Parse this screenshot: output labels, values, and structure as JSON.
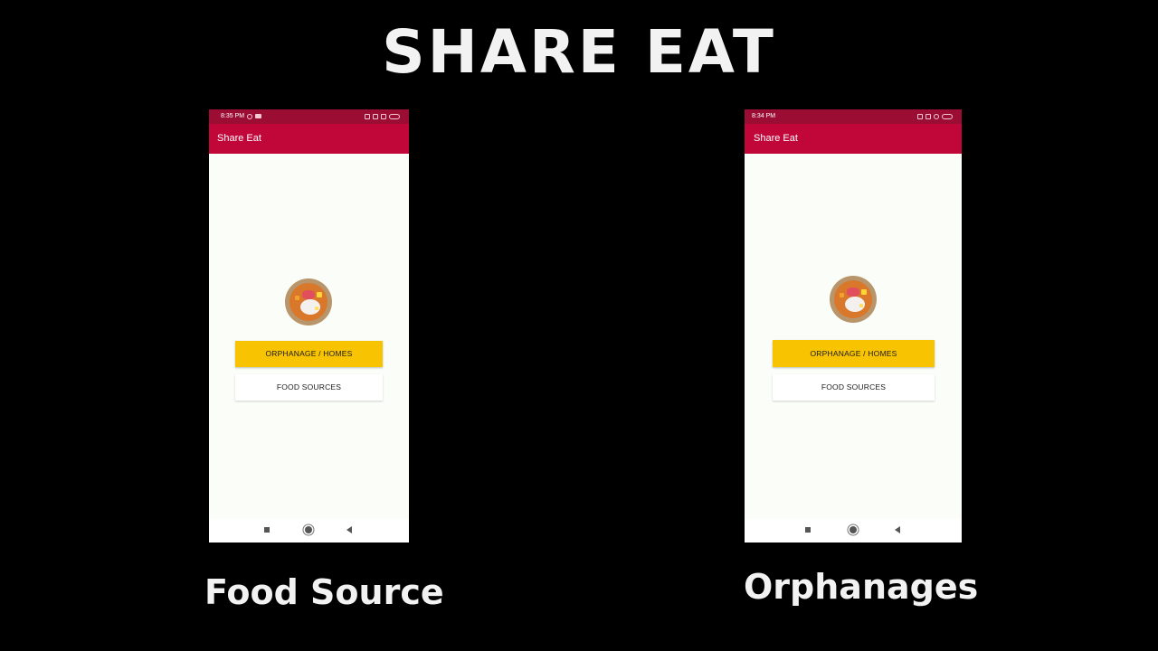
{
  "slide": {
    "title": "SHARE EAT",
    "caption_left": "Food Source",
    "caption_right": "Orphanages"
  },
  "phones": [
    {
      "status_time": "8:35 PM",
      "app_bar_title": "Share Eat",
      "primary_button_label": "ORPHANAGE / HOMES",
      "secondary_button_label": "FOOD SOURCES"
    },
    {
      "status_time": "8:34 PM",
      "app_bar_title": "Share Eat",
      "primary_button_label": "ORPHANAGE / HOMES",
      "secondary_button_label": "FOOD SOURCES"
    }
  ],
  "icons": {
    "logo": "food-bowl-icon",
    "nav_recents": "square-icon",
    "nav_home": "circle-icon",
    "nav_back": "triangle-back-icon"
  },
  "colors": {
    "background": "#000000",
    "status_bar": "#9b0d33",
    "app_bar": "#c1073a",
    "primary_button": "#f8c300",
    "screen_background": "#fbfef8",
    "title_text": "#f2f2f2"
  }
}
